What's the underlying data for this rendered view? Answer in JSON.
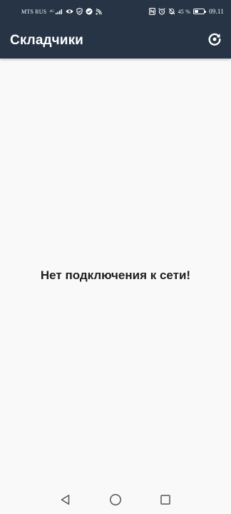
{
  "status_bar": {
    "carrier": "MTS RUS",
    "network_type": "4G",
    "battery_percent": "45 %",
    "battery_level": 0.45,
    "time": "09.11",
    "icons": [
      "signal-icon",
      "eye-icon",
      "shield-icon",
      "check-circle-icon",
      "cast-icon",
      "nfc-icon",
      "alarm-icon",
      "bell-off-icon",
      "battery-icon"
    ]
  },
  "app_bar": {
    "title": "Складчики",
    "action_icon": "refresh-icon"
  },
  "content": {
    "message": "Нет подключения к сети!"
  },
  "nav_bar": {
    "icons": [
      "back-icon",
      "home-icon",
      "recents-icon"
    ]
  },
  "colors": {
    "header_background": "#263445",
    "page_background": "#f9f9f9",
    "text_primary": "#1e1e1e",
    "on_header": "#ffffff"
  }
}
